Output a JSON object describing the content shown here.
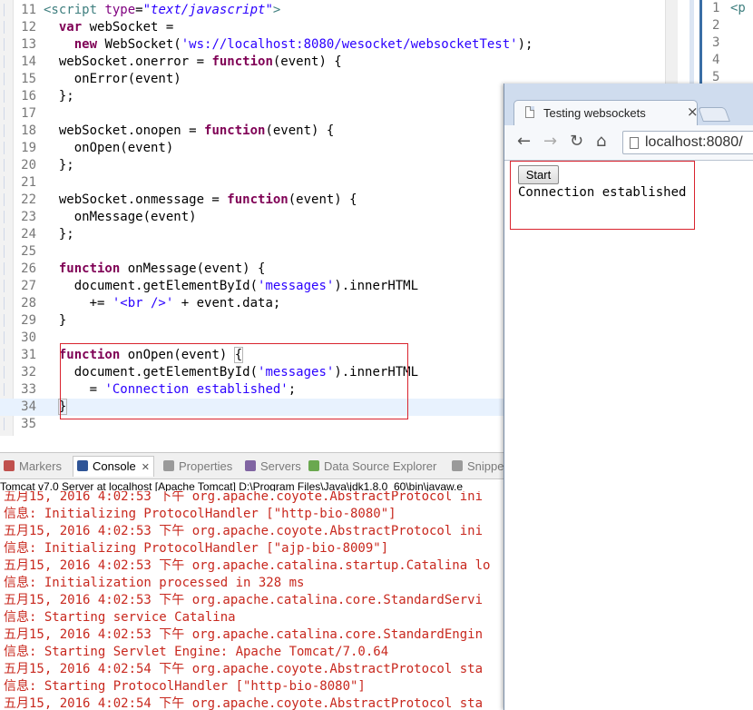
{
  "editor": {
    "lines": [
      {
        "num": "11",
        "html": "<span class=\"tag\">&lt;script</span> <span class=\"attr\">type</span>=<span class=\"attrval\">\"text/javascript\"</span><span class=\"tag\">&gt;</span>"
      },
      {
        "num": "12",
        "html": "  <span class=\"kw\">var</span> webSocket ="
      },
      {
        "num": "13",
        "html": "    <span class=\"kw\">new</span> WebSocket(<span class=\"str\">'ws://localhost:8080/wesocket/websocketTest'</span>);"
      },
      {
        "num": "14",
        "html": "  webSocket.onerror = <span class=\"kw\">function</span>(event) {"
      },
      {
        "num": "15",
        "html": "    onError(event)"
      },
      {
        "num": "16",
        "html": "  };"
      },
      {
        "num": "17",
        "html": ""
      },
      {
        "num": "18",
        "html": "  webSocket.onopen = <span class=\"kw\">function</span>(event) {"
      },
      {
        "num": "19",
        "html": "    onOpen(event)"
      },
      {
        "num": "20",
        "html": "  };"
      },
      {
        "num": "21",
        "html": ""
      },
      {
        "num": "22",
        "html": "  webSocket.onmessage = <span class=\"kw\">function</span>(event) {"
      },
      {
        "num": "23",
        "html": "    onMessage(event)"
      },
      {
        "num": "24",
        "html": "  };"
      },
      {
        "num": "25",
        "html": ""
      },
      {
        "num": "26",
        "html": "  <span class=\"kw\">function</span> onMessage(event) {"
      },
      {
        "num": "27",
        "html": "    document.getElementById(<span class=\"str\">'messages'</span>).innerHTML"
      },
      {
        "num": "28",
        "html": "      += <span class=\"str\">'&lt;br /&gt;'</span> + event.data;"
      },
      {
        "num": "29",
        "html": "  }"
      },
      {
        "num": "30",
        "html": ""
      },
      {
        "num": "31",
        "html": "  <span class=\"kw\">function</span> onOpen(event) <span class=\"bracket\">{</span>"
      },
      {
        "num": "32",
        "html": "    document.getElementById(<span class=\"str\">'messages'</span>).innerHTML"
      },
      {
        "num": "33",
        "html": "      = <span class=\"str\">'Connection established'</span>;"
      },
      {
        "num": "34",
        "html": "  <span class=\"bracket\">}</span>"
      },
      {
        "num": "35",
        "html": ""
      }
    ],
    "current_line": "34"
  },
  "editor2": {
    "lines": [
      {
        "num": "1",
        "code": "<p"
      },
      {
        "num": "2",
        "code": ""
      },
      {
        "num": "3",
        "code": ""
      },
      {
        "num": "4",
        "code": ""
      },
      {
        "num": "5",
        "code": ""
      }
    ]
  },
  "browser": {
    "tab_title": "Testing websockets",
    "tab_close": "×",
    "url": "localhost:8080/",
    "nav": {
      "back": "←",
      "forward": "→",
      "reload": "↻",
      "home": "⌂"
    },
    "start_label": "Start",
    "messages": "Connection established"
  },
  "views": {
    "tabs": [
      {
        "id": "vt-markers",
        "label": "Markers",
        "icon_color": "#c0504d"
      },
      {
        "id": "vt-console",
        "label": "Console",
        "icon_color": "#2f5597"
      },
      {
        "id": "vt-properties",
        "label": "Properties",
        "icon_color": "#9a9a9a"
      },
      {
        "id": "vt-servers",
        "label": "Servers",
        "icon_color": "#8064a2"
      },
      {
        "id": "vt-dse",
        "label": "Data Source Explorer",
        "icon_color": "#6aa84f"
      },
      {
        "id": "vt-snippets",
        "label": "Snippe",
        "icon_color": "#9a9a9a"
      }
    ],
    "console_close": "✕"
  },
  "console": {
    "header": "Tomcat v7.0 Server at localhost [Apache Tomcat] D:\\Program Files\\Java\\jdk1.8.0_60\\bin\\javaw.e",
    "lines": [
      "五月15, 2016 4:02:53 下午 org.apache.coyote.AbstractProtocol ini",
      "信息: Initializing ProtocolHandler [\"http-bio-8080\"]",
      "五月15, 2016 4:02:53 下午 org.apache.coyote.AbstractProtocol ini",
      "信息: Initializing ProtocolHandler [\"ajp-bio-8009\"]",
      "五月15, 2016 4:02:53 下午 org.apache.catalina.startup.Catalina lo",
      "信息: Initialization processed in 328 ms",
      "五月15, 2016 4:02:53 下午 org.apache.catalina.core.StandardServi",
      "信息: Starting service Catalina",
      "五月15, 2016 4:02:53 下午 org.apache.catalina.core.StandardEngin",
      "信息: Starting Servlet Engine: Apache Tomcat/7.0.64",
      "五月15, 2016 4:02:54 下午 org.apache.coyote.AbstractProtocol sta",
      "信息: Starting ProtocolHandler [\"http-bio-8080\"]",
      "五月15, 2016 4:02:54 下午 org.apache.coyote.AbstractProtocol sta"
    ]
  }
}
